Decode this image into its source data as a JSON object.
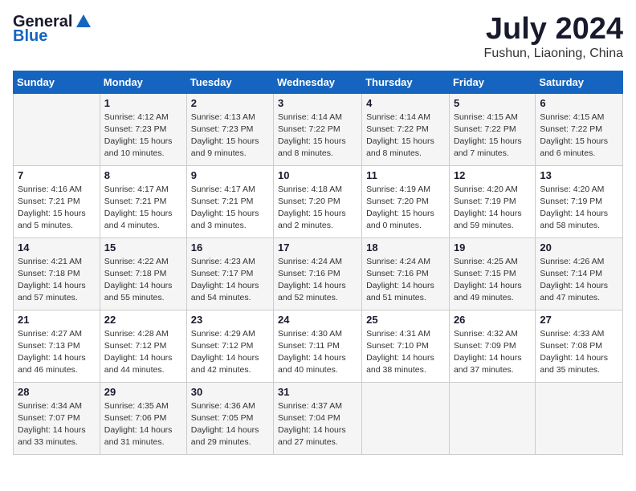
{
  "header": {
    "logo_general": "General",
    "logo_blue": "Blue",
    "month_year": "July 2024",
    "location": "Fushun, Liaoning, China"
  },
  "days_of_week": [
    "Sunday",
    "Monday",
    "Tuesday",
    "Wednesday",
    "Thursday",
    "Friday",
    "Saturday"
  ],
  "weeks": [
    [
      {
        "day": "",
        "sunrise": "",
        "sunset": "",
        "daylight": ""
      },
      {
        "day": "1",
        "sunrise": "Sunrise: 4:12 AM",
        "sunset": "Sunset: 7:23 PM",
        "daylight": "Daylight: 15 hours and 10 minutes."
      },
      {
        "day": "2",
        "sunrise": "Sunrise: 4:13 AM",
        "sunset": "Sunset: 7:23 PM",
        "daylight": "Daylight: 15 hours and 9 minutes."
      },
      {
        "day": "3",
        "sunrise": "Sunrise: 4:14 AM",
        "sunset": "Sunset: 7:22 PM",
        "daylight": "Daylight: 15 hours and 8 minutes."
      },
      {
        "day": "4",
        "sunrise": "Sunrise: 4:14 AM",
        "sunset": "Sunset: 7:22 PM",
        "daylight": "Daylight: 15 hours and 8 minutes."
      },
      {
        "day": "5",
        "sunrise": "Sunrise: 4:15 AM",
        "sunset": "Sunset: 7:22 PM",
        "daylight": "Daylight: 15 hours and 7 minutes."
      },
      {
        "day": "6",
        "sunrise": "Sunrise: 4:15 AM",
        "sunset": "Sunset: 7:22 PM",
        "daylight": "Daylight: 15 hours and 6 minutes."
      }
    ],
    [
      {
        "day": "7",
        "sunrise": "Sunrise: 4:16 AM",
        "sunset": "Sunset: 7:21 PM",
        "daylight": "Daylight: 15 hours and 5 minutes."
      },
      {
        "day": "8",
        "sunrise": "Sunrise: 4:17 AM",
        "sunset": "Sunset: 7:21 PM",
        "daylight": "Daylight: 15 hours and 4 minutes."
      },
      {
        "day": "9",
        "sunrise": "Sunrise: 4:17 AM",
        "sunset": "Sunset: 7:21 PM",
        "daylight": "Daylight: 15 hours and 3 minutes."
      },
      {
        "day": "10",
        "sunrise": "Sunrise: 4:18 AM",
        "sunset": "Sunset: 7:20 PM",
        "daylight": "Daylight: 15 hours and 2 minutes."
      },
      {
        "day": "11",
        "sunrise": "Sunrise: 4:19 AM",
        "sunset": "Sunset: 7:20 PM",
        "daylight": "Daylight: 15 hours and 0 minutes."
      },
      {
        "day": "12",
        "sunrise": "Sunrise: 4:20 AM",
        "sunset": "Sunset: 7:19 PM",
        "daylight": "Daylight: 14 hours and 59 minutes."
      },
      {
        "day": "13",
        "sunrise": "Sunrise: 4:20 AM",
        "sunset": "Sunset: 7:19 PM",
        "daylight": "Daylight: 14 hours and 58 minutes."
      }
    ],
    [
      {
        "day": "14",
        "sunrise": "Sunrise: 4:21 AM",
        "sunset": "Sunset: 7:18 PM",
        "daylight": "Daylight: 14 hours and 57 minutes."
      },
      {
        "day": "15",
        "sunrise": "Sunrise: 4:22 AM",
        "sunset": "Sunset: 7:18 PM",
        "daylight": "Daylight: 14 hours and 55 minutes."
      },
      {
        "day": "16",
        "sunrise": "Sunrise: 4:23 AM",
        "sunset": "Sunset: 7:17 PM",
        "daylight": "Daylight: 14 hours and 54 minutes."
      },
      {
        "day": "17",
        "sunrise": "Sunrise: 4:24 AM",
        "sunset": "Sunset: 7:16 PM",
        "daylight": "Daylight: 14 hours and 52 minutes."
      },
      {
        "day": "18",
        "sunrise": "Sunrise: 4:24 AM",
        "sunset": "Sunset: 7:16 PM",
        "daylight": "Daylight: 14 hours and 51 minutes."
      },
      {
        "day": "19",
        "sunrise": "Sunrise: 4:25 AM",
        "sunset": "Sunset: 7:15 PM",
        "daylight": "Daylight: 14 hours and 49 minutes."
      },
      {
        "day": "20",
        "sunrise": "Sunrise: 4:26 AM",
        "sunset": "Sunset: 7:14 PM",
        "daylight": "Daylight: 14 hours and 47 minutes."
      }
    ],
    [
      {
        "day": "21",
        "sunrise": "Sunrise: 4:27 AM",
        "sunset": "Sunset: 7:13 PM",
        "daylight": "Daylight: 14 hours and 46 minutes."
      },
      {
        "day": "22",
        "sunrise": "Sunrise: 4:28 AM",
        "sunset": "Sunset: 7:12 PM",
        "daylight": "Daylight: 14 hours and 44 minutes."
      },
      {
        "day": "23",
        "sunrise": "Sunrise: 4:29 AM",
        "sunset": "Sunset: 7:12 PM",
        "daylight": "Daylight: 14 hours and 42 minutes."
      },
      {
        "day": "24",
        "sunrise": "Sunrise: 4:30 AM",
        "sunset": "Sunset: 7:11 PM",
        "daylight": "Daylight: 14 hours and 40 minutes."
      },
      {
        "day": "25",
        "sunrise": "Sunrise: 4:31 AM",
        "sunset": "Sunset: 7:10 PM",
        "daylight": "Daylight: 14 hours and 38 minutes."
      },
      {
        "day": "26",
        "sunrise": "Sunrise: 4:32 AM",
        "sunset": "Sunset: 7:09 PM",
        "daylight": "Daylight: 14 hours and 37 minutes."
      },
      {
        "day": "27",
        "sunrise": "Sunrise: 4:33 AM",
        "sunset": "Sunset: 7:08 PM",
        "daylight": "Daylight: 14 hours and 35 minutes."
      }
    ],
    [
      {
        "day": "28",
        "sunrise": "Sunrise: 4:34 AM",
        "sunset": "Sunset: 7:07 PM",
        "daylight": "Daylight: 14 hours and 33 minutes."
      },
      {
        "day": "29",
        "sunrise": "Sunrise: 4:35 AM",
        "sunset": "Sunset: 7:06 PM",
        "daylight": "Daylight: 14 hours and 31 minutes."
      },
      {
        "day": "30",
        "sunrise": "Sunrise: 4:36 AM",
        "sunset": "Sunset: 7:05 PM",
        "daylight": "Daylight: 14 hours and 29 minutes."
      },
      {
        "day": "31",
        "sunrise": "Sunrise: 4:37 AM",
        "sunset": "Sunset: 7:04 PM",
        "daylight": "Daylight: 14 hours and 27 minutes."
      },
      {
        "day": "",
        "sunrise": "",
        "sunset": "",
        "daylight": ""
      },
      {
        "day": "",
        "sunrise": "",
        "sunset": "",
        "daylight": ""
      },
      {
        "day": "",
        "sunrise": "",
        "sunset": "",
        "daylight": ""
      }
    ]
  ]
}
